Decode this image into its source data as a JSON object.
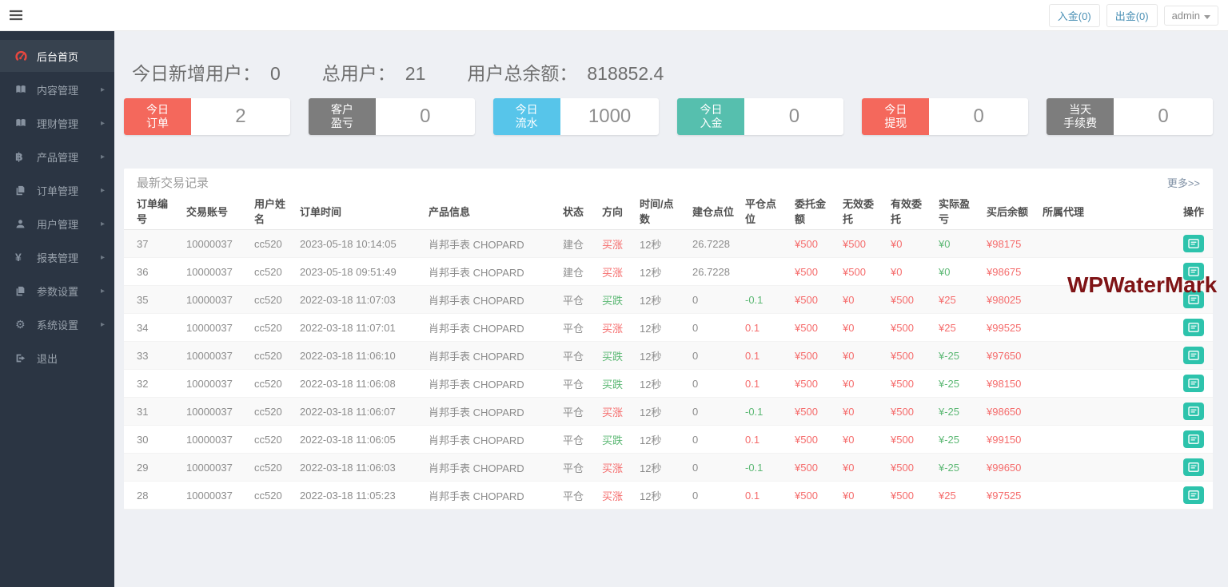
{
  "topbar": {
    "deposit_label": "入金(0)",
    "withdraw_label": "出金(0)",
    "user_label": "admin"
  },
  "sidebar": {
    "items": [
      {
        "name": "dashboard-home",
        "label": "后台首页",
        "icon": "dashboard-icon",
        "active": true,
        "has_arrow": false
      },
      {
        "name": "content-management",
        "label": "内容管理",
        "icon": "book-icon",
        "active": false,
        "has_arrow": true
      },
      {
        "name": "finance-management",
        "label": "理财管理",
        "icon": "book-icon",
        "active": false,
        "has_arrow": true
      },
      {
        "name": "product-management",
        "label": "产品管理",
        "icon": "bitcoin-icon",
        "active": false,
        "has_arrow": true
      },
      {
        "name": "order-management",
        "label": "订单管理",
        "icon": "copy-icon",
        "active": false,
        "has_arrow": true
      },
      {
        "name": "user-management",
        "label": "用户管理",
        "icon": "user-icon",
        "active": false,
        "has_arrow": true
      },
      {
        "name": "report-management",
        "label": "报表管理",
        "icon": "yen-icon",
        "active": false,
        "has_arrow": true
      },
      {
        "name": "parameter-settings",
        "label": "参数设置",
        "icon": "copy-icon",
        "active": false,
        "has_arrow": true
      },
      {
        "name": "system-settings",
        "label": "系统设置",
        "icon": "gears-icon",
        "active": false,
        "has_arrow": true
      },
      {
        "name": "logout",
        "label": "退出",
        "icon": "logout-icon",
        "active": false,
        "has_arrow": false
      }
    ]
  },
  "stats": [
    {
      "label": "今日新增用户：",
      "value": "0"
    },
    {
      "label": "总用户：",
      "value": "21"
    },
    {
      "label": "用户总余额：",
      "value": "818852.4"
    }
  ],
  "cards": [
    {
      "name": "today-orders",
      "lines": [
        "今日",
        "订单"
      ],
      "value": "2",
      "color": "#f4685c"
    },
    {
      "name": "customer-pnl",
      "lines": [
        "客户",
        "盈亏"
      ],
      "value": "0",
      "color": "#7d7d7d"
    },
    {
      "name": "today-turnover",
      "lines": [
        "今日",
        "流水"
      ],
      "value": "1000",
      "color": "#57c5ea"
    },
    {
      "name": "today-deposit",
      "lines": [
        "今日",
        "入金"
      ],
      "value": "0",
      "color": "#56bfae"
    },
    {
      "name": "today-withdrawal",
      "lines": [
        "今日",
        "提现"
      ],
      "value": "0",
      "color": "#f4685c"
    },
    {
      "name": "today-fee",
      "lines": [
        "当天",
        "手续费"
      ],
      "value": "0",
      "color": "#7d7d7d"
    }
  ],
  "panel": {
    "title": "最新交易记录",
    "more_link": "更多>>"
  },
  "table": {
    "headers": [
      "订单编号",
      "交易账号",
      "用户姓名",
      "订单时间",
      "产品信息",
      "状态",
      "方向",
      "时间/点数",
      "建仓点位",
      "平仓点位",
      "委托金额",
      "无效委托",
      "有效委托",
      "实际盈亏",
      "买后余额",
      "所属代理",
      "操作"
    ],
    "rows": [
      {
        "cells": [
          [
            "37",
            ""
          ],
          [
            "10000037",
            ""
          ],
          [
            "cc520",
            ""
          ],
          [
            "2023-05-18 10:14:05",
            ""
          ],
          [
            "肖邦手表 CHOPARD",
            ""
          ],
          [
            "建仓",
            ""
          ],
          [
            "买涨",
            "red"
          ],
          [
            "12秒",
            ""
          ],
          [
            "26.7228",
            ""
          ],
          [
            "",
            ""
          ],
          [
            "¥500",
            "red"
          ],
          [
            "¥500",
            "red"
          ],
          [
            "¥0",
            "red"
          ],
          [
            "¥0",
            "green"
          ],
          [
            "¥98175",
            "red"
          ],
          [
            "",
            ""
          ]
        ]
      },
      {
        "cells": [
          [
            "36",
            ""
          ],
          [
            "10000037",
            ""
          ],
          [
            "cc520",
            ""
          ],
          [
            "2023-05-18 09:51:49",
            ""
          ],
          [
            "肖邦手表 CHOPARD",
            ""
          ],
          [
            "建仓",
            ""
          ],
          [
            "买涨",
            "red"
          ],
          [
            "12秒",
            ""
          ],
          [
            "26.7228",
            ""
          ],
          [
            "",
            ""
          ],
          [
            "¥500",
            "red"
          ],
          [
            "¥500",
            "red"
          ],
          [
            "¥0",
            "red"
          ],
          [
            "¥0",
            "green"
          ],
          [
            "¥98675",
            "red"
          ],
          [
            "",
            ""
          ]
        ]
      },
      {
        "cells": [
          [
            "35",
            ""
          ],
          [
            "10000037",
            ""
          ],
          [
            "cc520",
            ""
          ],
          [
            "2022-03-18 11:07:03",
            ""
          ],
          [
            "肖邦手表 CHOPARD",
            ""
          ],
          [
            "平仓",
            ""
          ],
          [
            "买跌",
            "green"
          ],
          [
            "12秒",
            ""
          ],
          [
            "0",
            ""
          ],
          [
            "-0.1",
            "green"
          ],
          [
            "¥500",
            "red"
          ],
          [
            "¥0",
            "red"
          ],
          [
            "¥500",
            "red"
          ],
          [
            "¥25",
            "red"
          ],
          [
            "¥98025",
            "red"
          ],
          [
            "",
            ""
          ]
        ]
      },
      {
        "cells": [
          [
            "34",
            ""
          ],
          [
            "10000037",
            ""
          ],
          [
            "cc520",
            ""
          ],
          [
            "2022-03-18 11:07:01",
            ""
          ],
          [
            "肖邦手表 CHOPARD",
            ""
          ],
          [
            "平仓",
            ""
          ],
          [
            "买涨",
            "red"
          ],
          [
            "12秒",
            ""
          ],
          [
            "0",
            ""
          ],
          [
            "0.1",
            "red"
          ],
          [
            "¥500",
            "red"
          ],
          [
            "¥0",
            "red"
          ],
          [
            "¥500",
            "red"
          ],
          [
            "¥25",
            "red"
          ],
          [
            "¥99525",
            "red"
          ],
          [
            "",
            ""
          ]
        ]
      },
      {
        "cells": [
          [
            "33",
            ""
          ],
          [
            "10000037",
            ""
          ],
          [
            "cc520",
            ""
          ],
          [
            "2022-03-18 11:06:10",
            ""
          ],
          [
            "肖邦手表 CHOPARD",
            ""
          ],
          [
            "平仓",
            ""
          ],
          [
            "买跌",
            "green"
          ],
          [
            "12秒",
            ""
          ],
          [
            "0",
            ""
          ],
          [
            "0.1",
            "red"
          ],
          [
            "¥500",
            "red"
          ],
          [
            "¥0",
            "red"
          ],
          [
            "¥500",
            "red"
          ],
          [
            "¥-25",
            "green"
          ],
          [
            "¥97650",
            "red"
          ],
          [
            "",
            ""
          ]
        ]
      },
      {
        "cells": [
          [
            "32",
            ""
          ],
          [
            "10000037",
            ""
          ],
          [
            "cc520",
            ""
          ],
          [
            "2022-03-18 11:06:08",
            ""
          ],
          [
            "肖邦手表 CHOPARD",
            ""
          ],
          [
            "平仓",
            ""
          ],
          [
            "买跌",
            "green"
          ],
          [
            "12秒",
            ""
          ],
          [
            "0",
            ""
          ],
          [
            "0.1",
            "red"
          ],
          [
            "¥500",
            "red"
          ],
          [
            "¥0",
            "red"
          ],
          [
            "¥500",
            "red"
          ],
          [
            "¥-25",
            "green"
          ],
          [
            "¥98150",
            "red"
          ],
          [
            "",
            ""
          ]
        ]
      },
      {
        "cells": [
          [
            "31",
            ""
          ],
          [
            "10000037",
            ""
          ],
          [
            "cc520",
            ""
          ],
          [
            "2022-03-18 11:06:07",
            ""
          ],
          [
            "肖邦手表 CHOPARD",
            ""
          ],
          [
            "平仓",
            ""
          ],
          [
            "买涨",
            "red"
          ],
          [
            "12秒",
            ""
          ],
          [
            "0",
            ""
          ],
          [
            "-0.1",
            "green"
          ],
          [
            "¥500",
            "red"
          ],
          [
            "¥0",
            "red"
          ],
          [
            "¥500",
            "red"
          ],
          [
            "¥-25",
            "green"
          ],
          [
            "¥98650",
            "red"
          ],
          [
            "",
            ""
          ]
        ]
      },
      {
        "cells": [
          [
            "30",
            ""
          ],
          [
            "10000037",
            ""
          ],
          [
            "cc520",
            ""
          ],
          [
            "2022-03-18 11:06:05",
            ""
          ],
          [
            "肖邦手表 CHOPARD",
            ""
          ],
          [
            "平仓",
            ""
          ],
          [
            "买跌",
            "green"
          ],
          [
            "12秒",
            ""
          ],
          [
            "0",
            ""
          ],
          [
            "0.1",
            "red"
          ],
          [
            "¥500",
            "red"
          ],
          [
            "¥0",
            "red"
          ],
          [
            "¥500",
            "red"
          ],
          [
            "¥-25",
            "green"
          ],
          [
            "¥99150",
            "red"
          ],
          [
            "",
            ""
          ]
        ]
      },
      {
        "cells": [
          [
            "29",
            ""
          ],
          [
            "10000037",
            ""
          ],
          [
            "cc520",
            ""
          ],
          [
            "2022-03-18 11:06:03",
            ""
          ],
          [
            "肖邦手表 CHOPARD",
            ""
          ],
          [
            "平仓",
            ""
          ],
          [
            "买涨",
            "red"
          ],
          [
            "12秒",
            ""
          ],
          [
            "0",
            ""
          ],
          [
            "-0.1",
            "green"
          ],
          [
            "¥500",
            "red"
          ],
          [
            "¥0",
            "red"
          ],
          [
            "¥500",
            "red"
          ],
          [
            "¥-25",
            "green"
          ],
          [
            "¥99650",
            "red"
          ],
          [
            "",
            ""
          ]
        ]
      },
      {
        "cells": [
          [
            "28",
            ""
          ],
          [
            "10000037",
            ""
          ],
          [
            "cc520",
            ""
          ],
          [
            "2022-03-18 11:05:23",
            ""
          ],
          [
            "肖邦手表 CHOPARD",
            ""
          ],
          [
            "平仓",
            ""
          ],
          [
            "买涨",
            "red"
          ],
          [
            "12秒",
            ""
          ],
          [
            "0",
            ""
          ],
          [
            "0.1",
            "red"
          ],
          [
            "¥500",
            "red"
          ],
          [
            "¥0",
            "red"
          ],
          [
            "¥500",
            "red"
          ],
          [
            "¥25",
            "red"
          ],
          [
            "¥97525",
            "red"
          ],
          [
            "",
            ""
          ]
        ]
      }
    ]
  },
  "watermark": {
    "text": "WPWaterMark",
    "color": "#7f1416"
  },
  "palette": {
    "accent_red": "#f56c6c",
    "accent_green": "#5cb874",
    "card_red": "#f4685c",
    "card_gray": "#7d7d7d",
    "card_blue": "#57c5ea",
    "card_teal": "#56bfae",
    "action_button_teal": "#2dc3ac",
    "sidebar_bg": "#2b3543",
    "sidebar_active_bg": "#37424f",
    "link_blue": "#4a90b5"
  }
}
